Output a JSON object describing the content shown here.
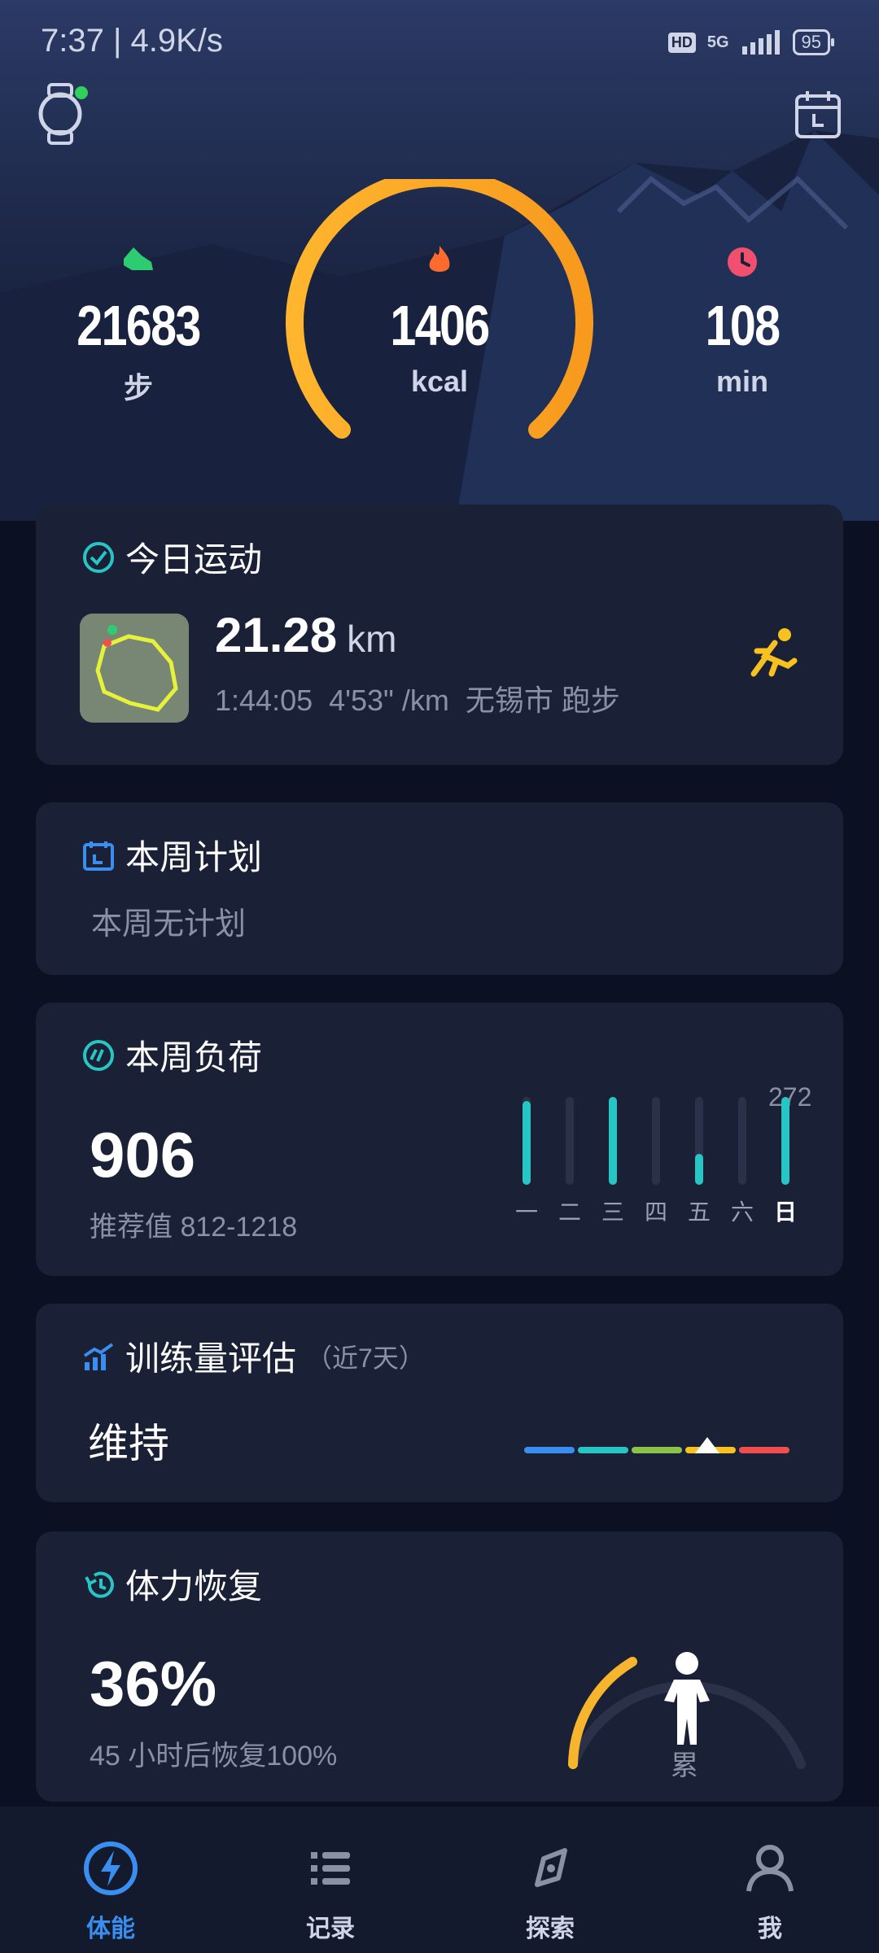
{
  "status_bar": {
    "time_speed": "7:37 | 4.9K/s",
    "hd": "HD",
    "network": "5G",
    "battery": "95"
  },
  "summary": {
    "steps_value": "21683",
    "steps_unit": "步",
    "calories_value": "1406",
    "calories_unit": "kcal",
    "minutes_value": "108",
    "minutes_unit": "min",
    "ring_progress": 1.0
  },
  "today_exercise": {
    "title": "今日运动",
    "distance": "21.28",
    "distance_unit": "km",
    "details": "1:44:05  4'53\" /km  无锡市 跑步"
  },
  "weekly_plan": {
    "title": "本周计划",
    "text": "本周无计划"
  },
  "weekly_load": {
    "title": "本周负荷",
    "value": "906",
    "recommend": "推荐值 812-1218",
    "peak_label": "272",
    "days": [
      "一",
      "二",
      "三",
      "四",
      "五",
      "六",
      "日"
    ],
    "levels": [
      0.95,
      0.0,
      1.0,
      0.0,
      0.35,
      0.0,
      1.0
    ]
  },
  "training_eval": {
    "title": "训练量评估",
    "subtitle": "（近7天）",
    "status": "维持"
  },
  "recovery": {
    "title": "体力恢复",
    "percent": "36%",
    "text": "45 小时后恢复100%",
    "state": "累",
    "level": 0.36
  },
  "nav": {
    "items": [
      "体能",
      "记录",
      "探索",
      "我"
    ],
    "active": "体能"
  },
  "colors": {
    "accent_orange": "#f7a823",
    "accent_cyan": "#27c6c4",
    "accent_blue": "#3a8ef0",
    "card": "#1a2036"
  }
}
